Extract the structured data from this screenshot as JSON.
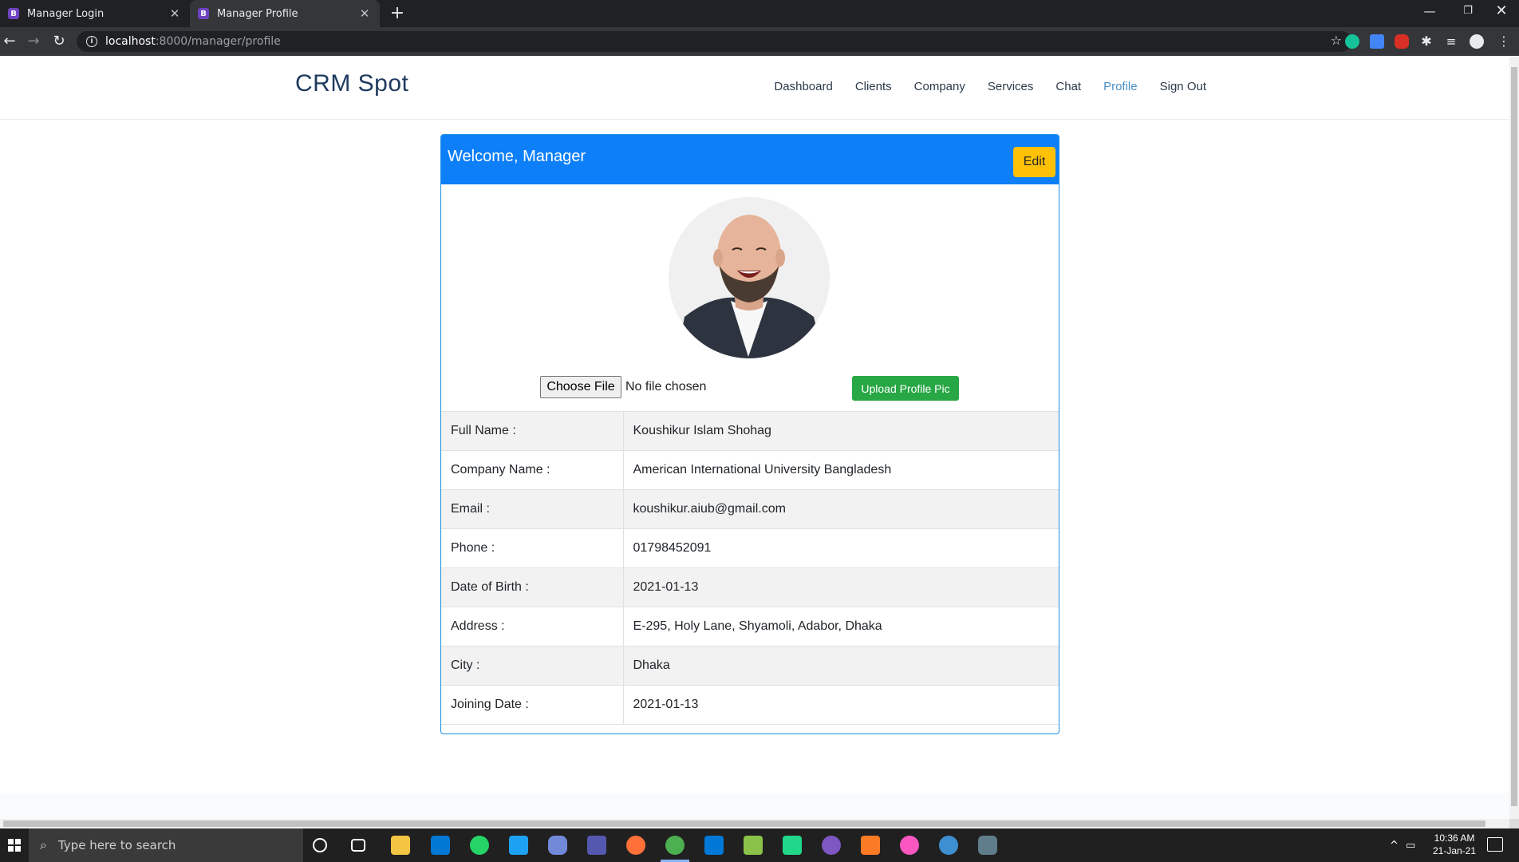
{
  "browser": {
    "tabs": [
      {
        "label": "Manager Login",
        "favicon": "B"
      },
      {
        "label": "Manager Profile",
        "favicon": "B"
      }
    ],
    "url_host": "localhost",
    "url_path": ":8000/manager/profile"
  },
  "site": {
    "brand": "CRM Spot",
    "nav": [
      "Dashboard",
      "Clients",
      "Company",
      "Services",
      "Chat",
      "Profile",
      "Sign Out"
    ],
    "active_nav": "Profile"
  },
  "profile": {
    "title": "Welcome, Manager",
    "edit_label": "Edit",
    "choose_file_label": "Choose File",
    "no_file_text": "No file chosen",
    "upload_label": "Upload Profile Pic",
    "fields": [
      {
        "label": "Full Name :",
        "value": "Koushikur Islam Shohag"
      },
      {
        "label": "Company Name :",
        "value": "American International University Bangladesh"
      },
      {
        "label": "Email :",
        "value": "koushikur.aiub@gmail.com"
      },
      {
        "label": "Phone :",
        "value": "01798452091"
      },
      {
        "label": "Date of Birth :",
        "value": "2021-01-13"
      },
      {
        "label": "Address :",
        "value": "E-295, Holy Lane, Shyamoli, Adabor, Dhaka"
      },
      {
        "label": "City :",
        "value": "Dhaka"
      },
      {
        "label": "Joining Date :",
        "value": "2021-01-13"
      }
    ]
  },
  "taskbar": {
    "search_placeholder": "Type here to search",
    "time": "10:36 AM",
    "date": "21-Jan-21"
  },
  "colors": {
    "header_blue": "#0d7ff8",
    "edit_yellow": "#ffc107",
    "upload_green": "#28a745",
    "active_link": "#4a90c6"
  }
}
